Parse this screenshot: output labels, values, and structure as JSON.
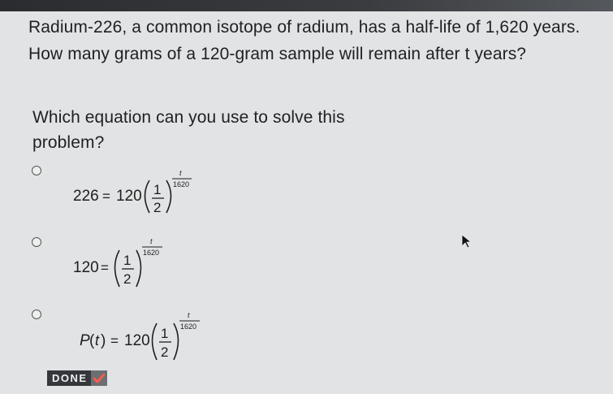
{
  "question": {
    "line1": "Radium-226, a common isotope of radium, has a half-life of 1,620 years.",
    "line2": "How many grams of a 120-gram sample will remain after t years?",
    "prompt1": "Which equation can you use to solve this",
    "prompt2": "problem?"
  },
  "options": [
    {
      "lhs": "226",
      "coef": "120",
      "base_num": "1",
      "base_den": "2",
      "exp_num": "t",
      "exp_den": "1620"
    },
    {
      "lhs": "120",
      "base_num": "1",
      "base_den": "2",
      "exp_num": "t",
      "exp_den": "1620"
    },
    {
      "lhs_func": "P",
      "lhs_arg": "t",
      "coef": "120",
      "base_num": "1",
      "base_den": "2",
      "exp_num": "t",
      "exp_den": "1620"
    }
  ],
  "done_button": {
    "label": "DONE",
    "icon": "check-icon"
  },
  "colors": {
    "done_bg": "#34373b",
    "check": "#ff5a4a"
  }
}
